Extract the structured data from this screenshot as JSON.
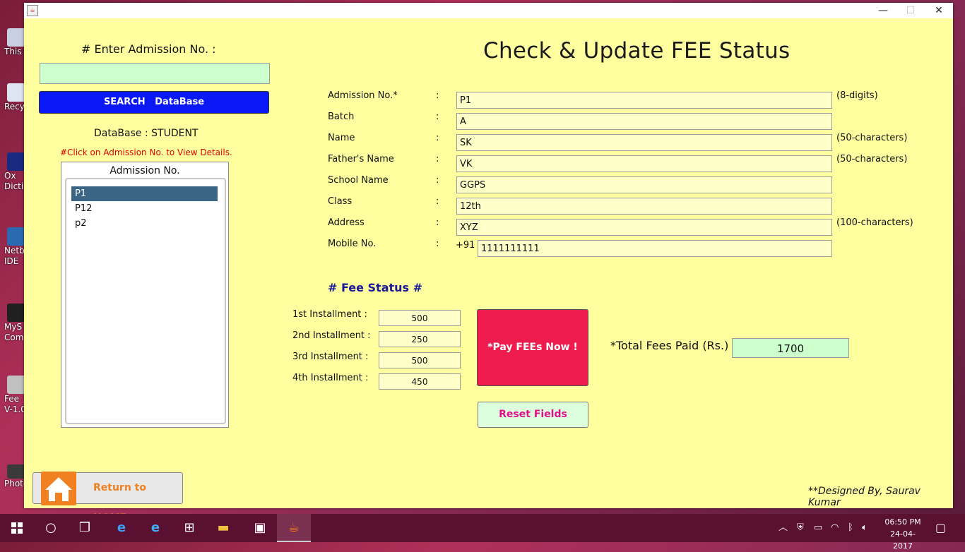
{
  "desktop": {
    "icons": [
      {
        "label": "This",
        "icon": "computer-icon",
        "color": "#c8d0e0"
      },
      {
        "label": "Recy",
        "icon": "recycle-bin-icon",
        "color": "#dde6f0"
      },
      {
        "label": "Ox Dicti",
        "icon": "dictionary-icon",
        "color": "#1a2a80"
      },
      {
        "label": "Netb IDE",
        "icon": "netbeans-icon",
        "color": "#2a6ab0"
      },
      {
        "label": "MyS Com",
        "icon": "mysql-icon",
        "color": "#202020"
      },
      {
        "label": "Fee V-1.0",
        "icon": "database-icon",
        "color": "#c0c0c0"
      },
      {
        "label": "Photo",
        "icon": "photo-icon",
        "color": "#3a3a3a"
      }
    ]
  },
  "window": {
    "title_icon": "java-icon",
    "minimize": "—",
    "maximize": "☐",
    "close": "✕"
  },
  "header": {
    "title": "Check & Update FEE Status"
  },
  "search": {
    "heading": "# Enter Admission No. :",
    "value": "",
    "button_label": "SEARCH   DataBase",
    "database_label": "DataBase : STUDENT",
    "hint": "#Click on Admission No. to View Details."
  },
  "admission_list": {
    "title": "Admission No.",
    "items": [
      "P1",
      "P12",
      "p2"
    ],
    "selected_index": 0
  },
  "form": {
    "fields": [
      {
        "label": "Admission No.*",
        "value": "P1",
        "hint": "(8-digits)"
      },
      {
        "label": "Batch",
        "value": "A",
        "hint": ""
      },
      {
        "label": "Name",
        "value": "SK",
        "hint": "(50-characters)"
      },
      {
        "label": "Father's Name",
        "value": "VK",
        "hint": "(50-characters)"
      },
      {
        "label": "School Name",
        "value": "GGPS",
        "hint": ""
      },
      {
        "label": "Class",
        "value": "12th",
        "hint": ""
      },
      {
        "label": "Address",
        "value": "XYZ",
        "hint": "(100-characters)"
      },
      {
        "label": "Mobile No.",
        "value": "1111111111",
        "hint": ""
      }
    ],
    "colon": ":",
    "mobile_prefix": "+91"
  },
  "fee": {
    "heading": "# Fee Status #",
    "installments": [
      {
        "label": "1st Installment  :",
        "value": "500"
      },
      {
        "label": "2nd Installment :",
        "value": "250"
      },
      {
        "label": "3rd Installment :",
        "value": "500"
      },
      {
        "label": "4th Installment :",
        "value": "450"
      }
    ],
    "pay_button": "*Pay FEEs Now !",
    "reset_button": "Reset Fields",
    "total_label": "*Total Fees Paid (Rs.) :",
    "total_value": "1700"
  },
  "footer": {
    "home_button": "Return to HOME",
    "credit": "**Designed By, Saurav Kumar"
  },
  "taskbar": {
    "apps": [
      "windows-start-icon",
      "cortana-icon",
      "task-view-icon",
      "edge-icon",
      "internet-explorer-icon",
      "store-icon",
      "file-explorer-icon",
      "photos-app-icon",
      "java-app-icon"
    ],
    "time": "06:50 PM",
    "date": "24-04-2017"
  },
  "colors": {
    "window_bg": "#ffffa0",
    "search_button": "#0a18f5",
    "pay_button": "#ee1c4e",
    "reset_text": "#e0108a",
    "fee_heading": "#1a1a99",
    "hint_red": "#e00000",
    "home_orange": "#f08020"
  }
}
